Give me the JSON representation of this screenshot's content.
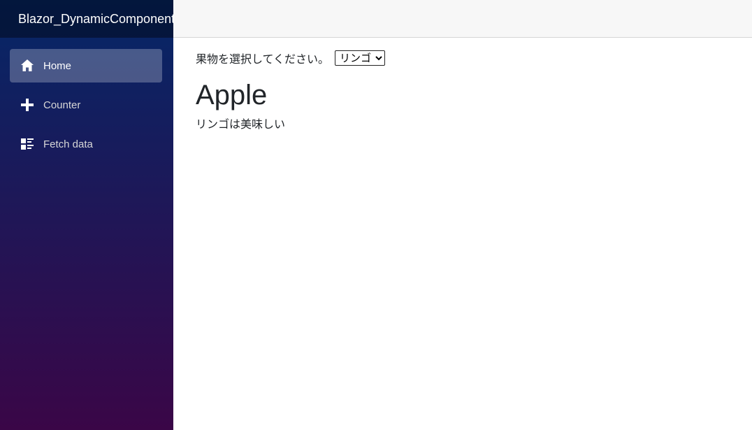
{
  "app": {
    "title": "Blazor_DynamicComponent"
  },
  "sidebar": {
    "items": [
      {
        "label": "Home",
        "icon": "home-icon",
        "active": true
      },
      {
        "label": "Counter",
        "icon": "plus-icon",
        "active": false
      },
      {
        "label": "Fetch data",
        "icon": "list-icon",
        "active": false
      }
    ]
  },
  "main": {
    "select_label": "果物を選択してください。",
    "select": {
      "selected": "リンゴ",
      "options": [
        "リンゴ"
      ]
    },
    "fruit_name": "Apple",
    "fruit_description": "リンゴは美味しい"
  },
  "colors": {
    "sidebar_top": "#052767",
    "sidebar_bottom": "#3a0647",
    "topbar": "#f7f7f7"
  }
}
